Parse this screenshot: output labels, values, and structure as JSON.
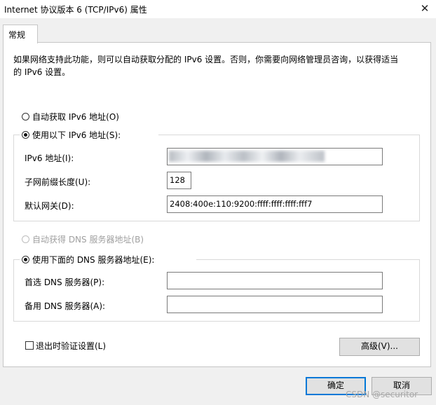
{
  "window": {
    "title": "Internet 协议版本 6 (TCP/IPv6) 属性",
    "close_glyph": "✕"
  },
  "tab": {
    "label": "常规"
  },
  "description": "如果网络支持此功能，则可以自动获取分配的 IPv6 设置。否则，你需要向网络管理员咨询，以获得适当的 IPv6 设置。",
  "ip_section": {
    "auto_label": "自动获取 IPv6 地址(O)",
    "manual_label": "使用以下 IPv6 地址(S):",
    "selected": "manual",
    "fields": [
      {
        "label": "IPv6 地址(I):",
        "value": "",
        "redacted": true
      },
      {
        "label": "子网前缀长度(U):",
        "value": "128"
      },
      {
        "label": "默认网关(D):",
        "value": "2408:400e:110:9200:ffff:ffff:ffff:fff7"
      }
    ]
  },
  "dns_section": {
    "auto_label": "自动获得 DNS 服务器地址(B)",
    "manual_label": "使用下面的 DNS 服务器地址(E):",
    "selected": "manual",
    "fields": [
      {
        "label": "首选 DNS 服务器(P):",
        "value": ""
      },
      {
        "label": "备用 DNS 服务器(A):",
        "value": ""
      }
    ]
  },
  "validate_checkbox": {
    "label": "退出时验证设置(L)",
    "checked": false
  },
  "buttons": {
    "advanced": "高级(V)...",
    "ok": "确定",
    "cancel": "取消"
  },
  "watermark": "CSDN @securitor",
  "colors": {
    "accent": "#0078d7",
    "panel": "#ffffff",
    "dialog_bg": "#f0f0f0"
  }
}
